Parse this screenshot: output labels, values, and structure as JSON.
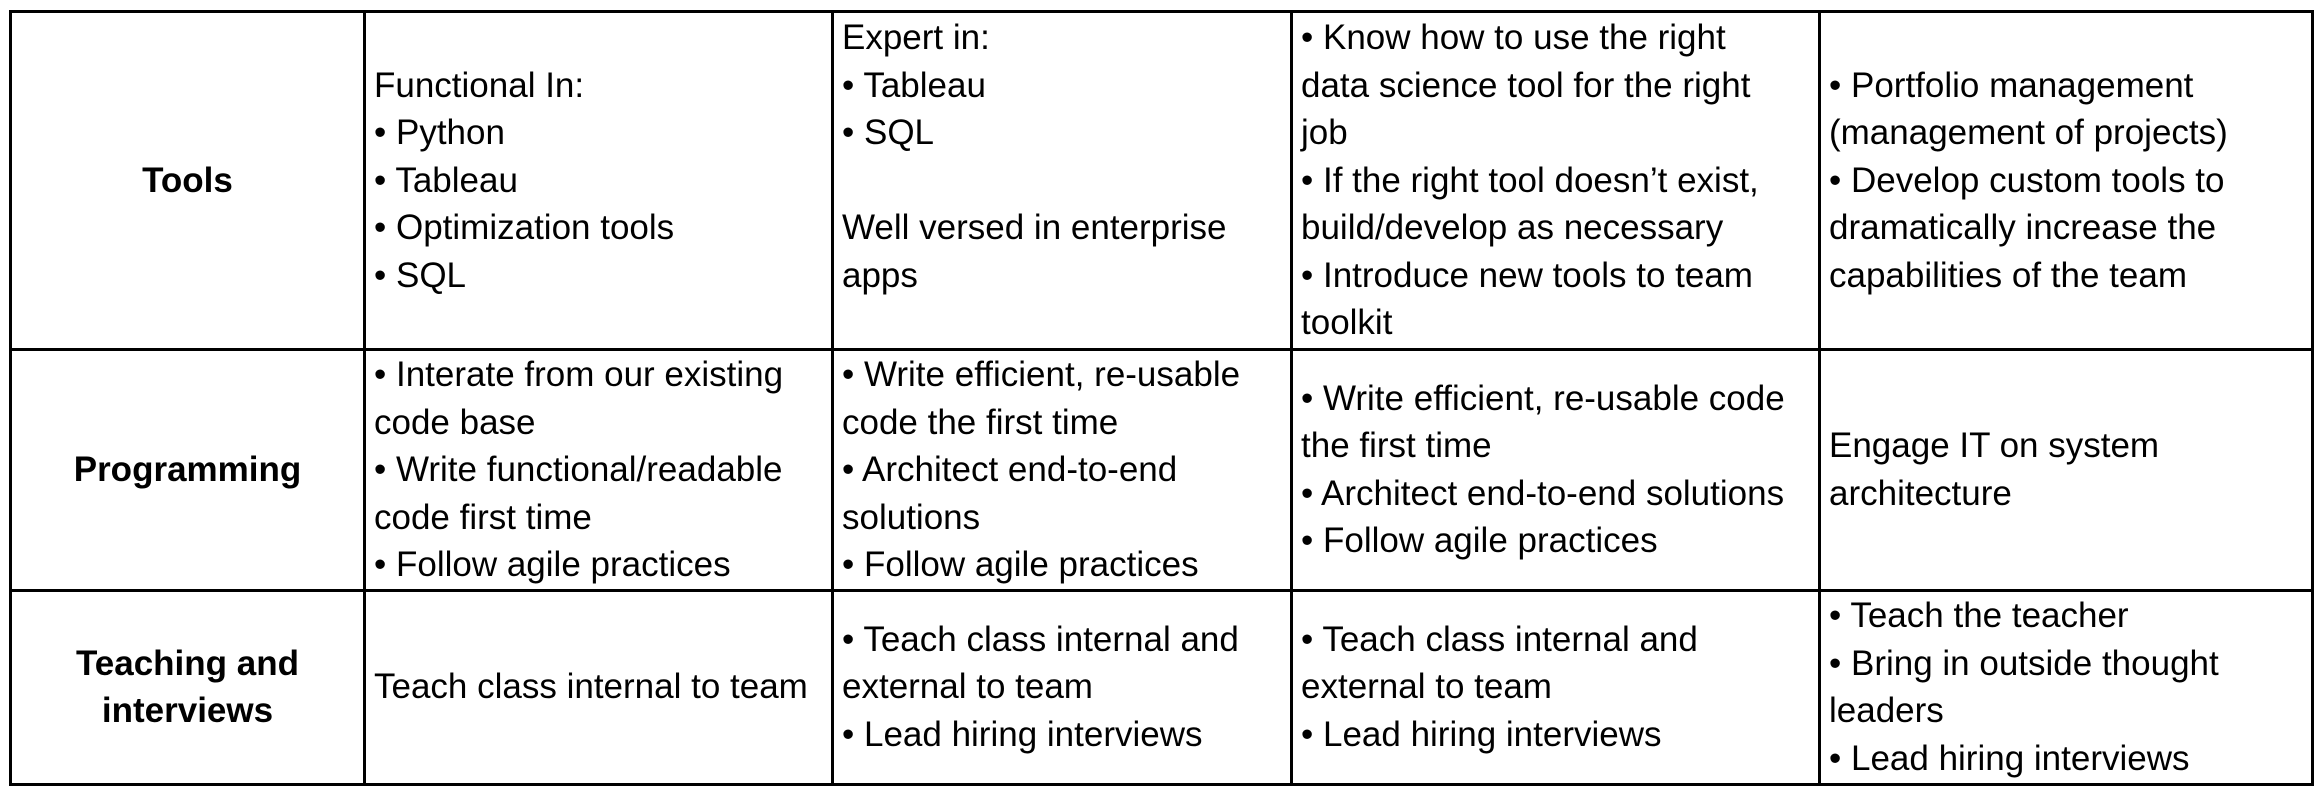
{
  "table": {
    "rows": [
      {
        "label": [
          "Tools"
        ],
        "cells": [
          [
            "Functional In:",
            "• Python",
            "• Tableau",
            "• Optimization tools",
            "• SQL"
          ],
          [
            "Expert in:",
            "• Tableau",
            "• SQL",
            "",
            "Well versed in enterprise",
            "apps",
            ""
          ],
          [
            "• Know how to use the right",
            "data science tool for the right",
            "job",
            "• If the right tool doesn’t exist,",
            "build/develop as necessary",
            "• Introduce new tools to team",
            "toolkit"
          ],
          [
            "• Portfolio management",
            "(management of projects)",
            "• Develop custom tools to",
            "dramatically increase the",
            "capabilities of the team"
          ]
        ]
      },
      {
        "label": [
          "Programming"
        ],
        "cells": [
          [
            "• Interate from our existing",
            "code base",
            "• Write functional/readable",
            "code first time",
            "• Follow agile practices"
          ],
          [
            "• Write efficient, re-usable",
            "code the first time",
            "• Architect end-to-end",
            "solutions",
            "• Follow agile practices"
          ],
          [
            "• Write efficient, re-usable code",
            "the first time",
            "• Architect end-to-end solutions",
            "• Follow agile practices"
          ],
          [
            "Engage IT on system",
            "architecture"
          ]
        ]
      },
      {
        "label": [
          "Teaching and",
          "interviews"
        ],
        "cells": [
          [
            "Teach class internal to team"
          ],
          [
            "• Teach class internal and",
            "external to team",
            "• Lead hiring interviews"
          ],
          [
            "• Teach class internal and",
            "external to team",
            "• Lead hiring interviews"
          ],
          [
            "• Teach the teacher",
            "• Bring in outside thought",
            "leaders",
            "• Lead hiring interviews"
          ]
        ]
      }
    ]
  }
}
